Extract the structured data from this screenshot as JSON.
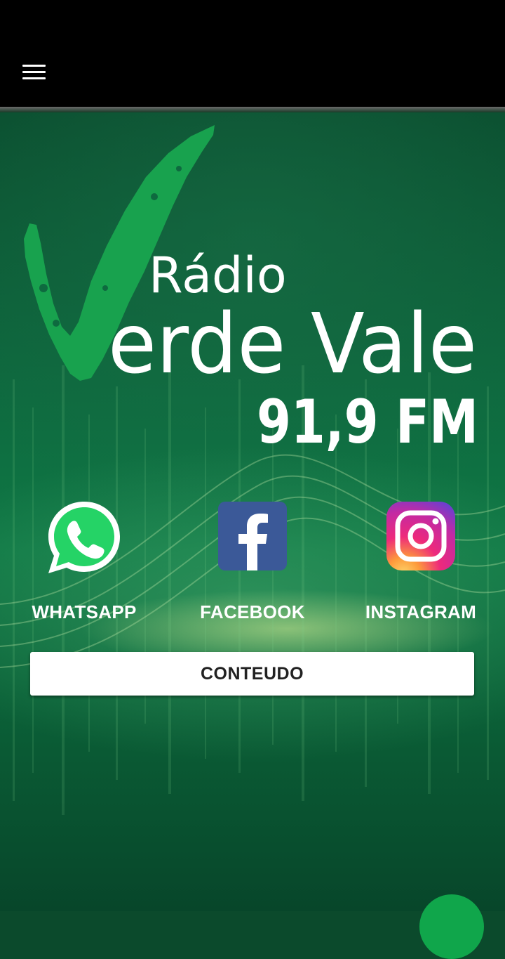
{
  "header": {
    "menu_icon": "hamburger-menu-icon"
  },
  "logo": {
    "line1": "Rádio",
    "line2": "erde Vale",
    "line3": "91,9 FM",
    "mark_color": "#18a24e"
  },
  "social": [
    {
      "label": "WHATSAPP",
      "icon": "whatsapp-icon",
      "color": "#25d366"
    },
    {
      "label": "FACEBOOK",
      "icon": "facebook-icon",
      "color": "#3b5998"
    },
    {
      "label": "INSTAGRAM",
      "icon": "instagram-icon",
      "color": "#d6249f"
    }
  ],
  "content_button": {
    "label": "CONTEUDO"
  },
  "fab": {
    "icon": "floating-action-button",
    "color": "#10a64b"
  }
}
